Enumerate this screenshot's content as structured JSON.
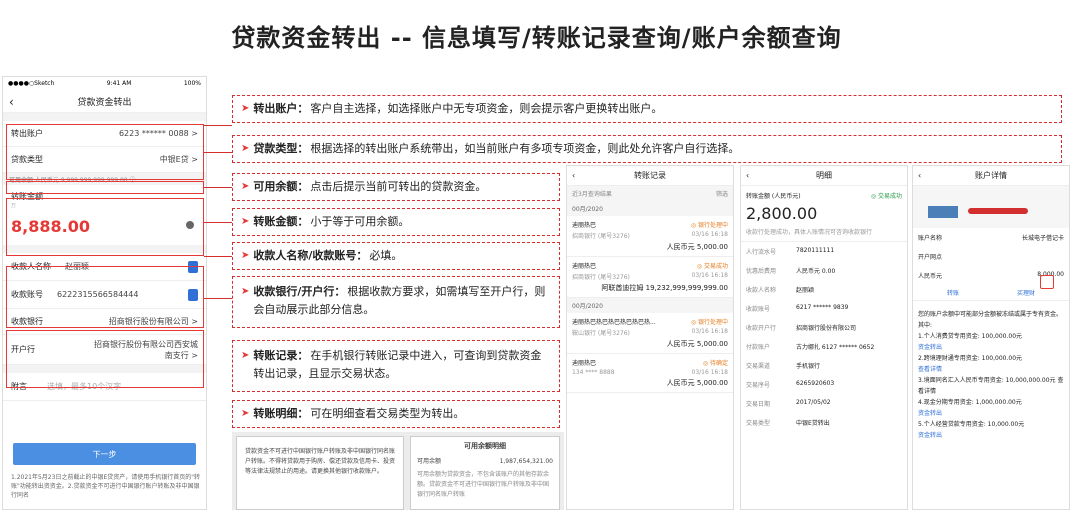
{
  "title": "贷款资金转出 -- 信息填写/转账记录查询/账户余额查询",
  "phone": {
    "status": {
      "carrier": "●●●●○Sketch",
      "time": "9:41 AM",
      "battery": "100%"
    },
    "nav_title": "贷款资金转出",
    "out_account": {
      "label": "转出账户",
      "value": "6223 ****** 0088 >"
    },
    "loan_type": {
      "label": "贷款类型",
      "value": "中银E贷 >"
    },
    "balance_line": "可用余额 人民币元 9,999,999,999,999.00 ⓘ",
    "amount": {
      "label": "转账金额",
      "unit": "万",
      "value": "8,888.00"
    },
    "payee_name": {
      "label": "收款人名称",
      "value": "赵丽颖"
    },
    "payee_account": {
      "label": "收款账号",
      "value": "6222315566584444"
    },
    "bank": {
      "label": "收款银行",
      "value": "招商银行股份有限公司 >"
    },
    "branch": {
      "label": "开户行",
      "value": "招商银行股份有限公司西安城南支行 >"
    },
    "remark": {
      "label": "附言",
      "placeholder": "选填，最多10个汉字"
    },
    "next": "下一步",
    "notes": "1.2021年5月23日之前截止的中银E贷资产，请使用手机银行首页的\"转账\"功能转出资资金。2.贷款资金不可进行中国银行账户转账及非中国银行同名"
  },
  "callouts": [
    {
      "key": "转出账户：",
      "text": "客户自主选择，如选择账户中无专项资金，则会提示客户更换转出账户。"
    },
    {
      "key": "贷款类型：",
      "text": "根据选择的转出账户系统带出，如当前账户有多项专项资金，则此处允许客户自行选择。"
    },
    {
      "key": "可用余额：",
      "text": "点击后提示当前可转出的贷款资金。"
    },
    {
      "key": "转账金额：",
      "text": "小于等于可用余额。"
    },
    {
      "key": "收款人名称/收款账号：",
      "text": "必填。"
    },
    {
      "key": "收款银行/开户行：",
      "text": "根据收款方要求，如需填写至开户行，则会自动展示此部分信息。"
    },
    {
      "key": "转账记录：",
      "text": "在手机银行转账记录中进入，可查询到贷款资金转出记录，且显示交易状态。"
    },
    {
      "key": "转账明细：",
      "text": "可在明细查看交易类型为转出。"
    }
  ],
  "records": {
    "title": "转账记录",
    "filter": "筛选",
    "range": "近3月查询结果",
    "month": "00月/2020",
    "items": [
      {
        "name": "迪丽热巴",
        "status": "◎ 银行处理中",
        "bank": "招商银行 (尾号3276)",
        "date": "03/16 16:18",
        "amount": "人民币元 5,000.00"
      },
      {
        "name": "迪丽热巴",
        "status": "◎ 交易成功",
        "bank": "招商银行 (尾号3276)",
        "date": "03/16 16:18",
        "amount": "阿联酋迪拉姆 19,232,999,999,999.00"
      },
      {
        "name": "迪丽热巴热巴热巴热巴热巴热...",
        "status": "◎ 银行处理中",
        "bank": "鞍山银行 (尾号3276)",
        "date": "03/16 16:18",
        "amount": "人民币元 5,000.00"
      },
      {
        "name": "迪丽热巴",
        "status": "◎ 待确定",
        "bank": "134 **** 8888",
        "date": "03/16 16:18",
        "amount": "人民币元 5,000.00"
      }
    ],
    "month2": "00月/2020"
  },
  "detail": {
    "title": "明细",
    "amount_label": "转账金额 (人民币元)",
    "status": "◎ 交易成功",
    "amount": "2,800.00",
    "desc": "收款行处理成功，具体入账情况可咨询收款银行",
    "rows": [
      [
        "人行流水号",
        "7820111111"
      ],
      [
        "优惠后费用",
        "人民币元 0.00"
      ],
      [
        "收款人名称",
        "赵丽颖"
      ],
      [
        "收款账号",
        "6217 ****** 9839"
      ],
      [
        "收款开户行",
        "招商银行股份有限公司"
      ],
      [
        "付款账户",
        "古力娜扎 6127 ****** 0652"
      ],
      [
        "交易渠道",
        "手机银行"
      ],
      [
        "交易序号",
        "6265920603"
      ],
      [
        "交易日期",
        "2017/05/02"
      ],
      [
        "交易类型",
        "中银E贷转出"
      ]
    ]
  },
  "account": {
    "title": "账户详情",
    "rows": [
      [
        "账户名称",
        "长城电子借记卡"
      ],
      [
        "开户网点",
        ""
      ],
      [
        "人民币元",
        "8,000.00"
      ]
    ],
    "actions": [
      "转账",
      "买理财"
    ],
    "info": [
      "您的账户余额中可能部分金额被冻结或属于专有资金。其中:",
      "1.个人消费贷专用资金: 100,000.00元",
      "资金转出",
      "2.跨境理财通专用资金: 100,000.00元",
      "查看详情",
      "3.境面同名汇入人民币专用资金: 10,000,000.00元 查看详情",
      "4.现金分期专用资金: 1,000,000.00元",
      "资金转出",
      "5.个人经营贷款专用资金: 10,000.00元",
      "资金转出"
    ]
  },
  "popup1": "贷款资金不可进行中国银行账户转账及非中国银行同名账户转账。不得将贷款用于购房、偿还贷款及信用卡、投资等法律法规禁止的用途。请更换其他银行收款账户。",
  "popup2": {
    "title": "可用余额明细",
    "label": "可用余额",
    "value": "1,987,654,321.00",
    "text": "可用余额为贷款资金，不包含该账户的其他存款余额。贷款资金不可进行中国银行账户转账及非中国银行同名账户转账"
  }
}
